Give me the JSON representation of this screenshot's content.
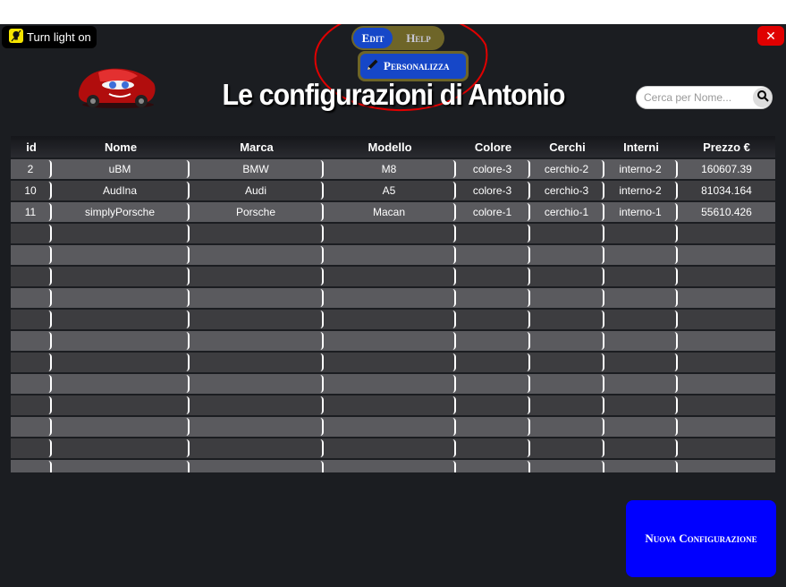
{
  "light_toggle": {
    "label": "Turn light on",
    "icon": "lightbulb-icon"
  },
  "close": {
    "label": "✕",
    "icon": "close-icon",
    "color": "#e00000"
  },
  "menu": {
    "edit_label": "Edit",
    "help_label": "Help",
    "personalizza_label": "Personalizza",
    "personalizza_icon": "pencil-icon"
  },
  "header": {
    "title": "Le configurazioni di Antonio",
    "logo": "car-logo"
  },
  "search": {
    "placeholder": "Cerca per Nome...",
    "icon": "search-icon"
  },
  "table": {
    "columns": [
      "id",
      "Nome",
      "Marca",
      "Modello",
      "Colore",
      "Cerchi",
      "Interni",
      "Prezzo €"
    ],
    "rows": [
      [
        "2",
        "uBM",
        "BMW",
        "M8",
        "colore-3",
        "cerchio-2",
        "interno-2",
        "160607.39"
      ],
      [
        "10",
        "AudIna",
        "Audi",
        "A5",
        "colore-3",
        "cerchio-3",
        "interno-2",
        "81034.164"
      ],
      [
        "11",
        "simplyPorsche",
        "Porsche",
        "Macan",
        "colore-1",
        "cerchio-1",
        "interno-1",
        "55610.426"
      ],
      [
        "",
        "",
        "",
        "",
        "",
        "",
        "",
        ""
      ],
      [
        "",
        "",
        "",
        "",
        "",
        "",
        "",
        ""
      ],
      [
        "",
        "",
        "",
        "",
        "",
        "",
        "",
        ""
      ],
      [
        "",
        "",
        "",
        "",
        "",
        "",
        "",
        ""
      ],
      [
        "",
        "",
        "",
        "",
        "",
        "",
        "",
        ""
      ],
      [
        "",
        "",
        "",
        "",
        "",
        "",
        "",
        ""
      ],
      [
        "",
        "",
        "",
        "",
        "",
        "",
        "",
        ""
      ],
      [
        "",
        "",
        "",
        "",
        "",
        "",
        "",
        ""
      ],
      [
        "",
        "",
        "",
        "",
        "",
        "",
        "",
        ""
      ],
      [
        "",
        "",
        "",
        "",
        "",
        "",
        "",
        ""
      ],
      [
        "",
        "",
        "",
        "",
        "",
        "",
        "",
        ""
      ],
      [
        "",
        "",
        "",
        "",
        "",
        "",
        "",
        ""
      ]
    ]
  },
  "actions": {
    "new_config_label": "Nuova Configurazione",
    "new_config_color": "#0000ff"
  },
  "colors": {
    "background": "#1b1d21",
    "accent": "#1647c8",
    "menu_bg": "#6e6528",
    "annotation": "#e00000"
  }
}
